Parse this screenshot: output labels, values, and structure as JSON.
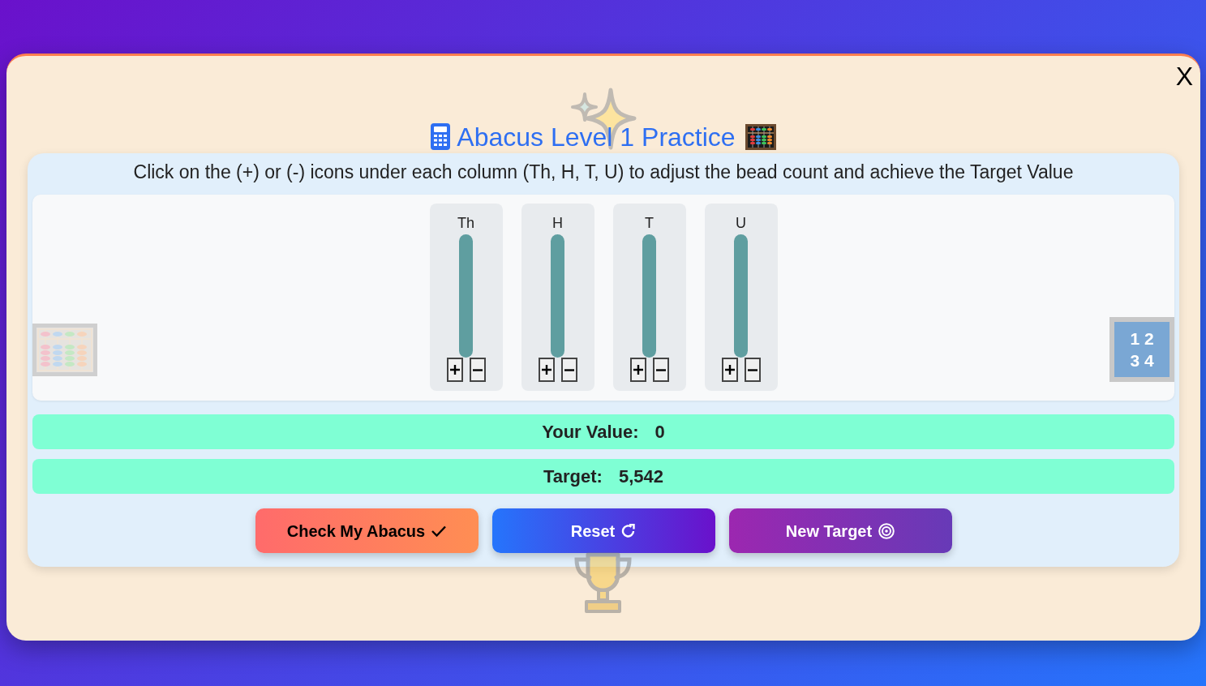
{
  "window": {
    "close_label": "X"
  },
  "title": {
    "text": "Abacus Level 1 Practice"
  },
  "instructions": "Click on the (+) or (-) icons under each column (Th, H, T, U) to adjust the bead count and achieve the Target Value",
  "columns": [
    {
      "label": "Th"
    },
    {
      "label": "H"
    },
    {
      "label": "T"
    },
    {
      "label": "U"
    }
  ],
  "number_tile": {
    "lines": [
      "1 2",
      "3 4"
    ]
  },
  "readouts": [
    {
      "label": "Your Value:",
      "value": "0"
    },
    {
      "label": "Target:",
      "value": "5,542"
    }
  ],
  "buttons": [
    {
      "label": "Check My Abacus",
      "kind": "check"
    },
    {
      "label": "Reset",
      "kind": "reset"
    },
    {
      "label": "New Target",
      "kind": "target"
    }
  ]
}
